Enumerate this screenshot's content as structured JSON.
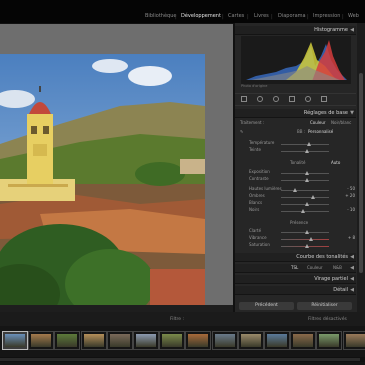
{
  "modules": [
    {
      "label": "Bibliothèque",
      "active": false
    },
    {
      "label": "Développement",
      "active": true
    },
    {
      "label": "Cartes",
      "active": false
    },
    {
      "label": "Livres",
      "active": false
    },
    {
      "label": "Diaporama",
      "active": false
    },
    {
      "label": "Impression",
      "active": false
    },
    {
      "label": "Web",
      "active": false
    }
  ],
  "histogram": {
    "title": "Histogramme",
    "info": "",
    "original_label": "Photo d'origine"
  },
  "basic": {
    "title": "Réglages de base",
    "treatment_label": "Traitement :",
    "treatment_color": "Couleur",
    "treatment_bw": "Noir/blanc",
    "wb_label": "BB :",
    "wb_value": "Personnalisé",
    "temperature_label": "Température",
    "temperature_value": "",
    "tint_label": "Teinte",
    "tint_value": "",
    "tone_label": "Tonalité",
    "tone_auto": "Auto",
    "exposure_label": "Exposition",
    "exposure_value": "",
    "contrast_label": "Contraste",
    "contrast_value": "",
    "highlights_label": "Hautes lumières",
    "highlights_value": "- 50",
    "shadows_label": "Ombres",
    "shadows_value": "+ 20",
    "whites_label": "Blancs",
    "whites_value": "",
    "blacks_label": "Noirs",
    "blacks_value": "- 10",
    "presence_label": "Présence",
    "clarity_label": "Clarté",
    "clarity_value": "",
    "vibrance_label": "Vibrance",
    "vibrance_value": "+ 8",
    "saturation_label": "Saturation",
    "saturation_value": ""
  },
  "panels": {
    "tone_curve": "Courbe des tonalités",
    "tsl_label": "TSL",
    "tsl_color": "Couleur",
    "tsl_bw": "N&B",
    "split_tone": "Virage partiel",
    "detail": "Détail"
  },
  "buttons": {
    "previous": "Précédent",
    "reset": "Réinitialiser"
  },
  "filmstrip": {
    "filter_label": "Filtre :",
    "filter_value": "Filtres désactivés",
    "thumb_count": 14
  },
  "colors": {
    "accent": "#e6e6e6",
    "panel_bg": "#262626"
  }
}
